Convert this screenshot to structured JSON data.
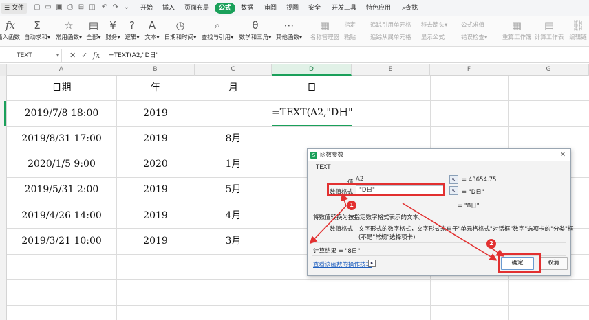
{
  "menu": {
    "file_label": "文件",
    "tabs": [
      "开始",
      "插入",
      "页面布局",
      "公式",
      "数据",
      "审阅",
      "视图",
      "安全",
      "开发工具",
      "特色应用"
    ],
    "active_tab": "公式",
    "search_label": "查找"
  },
  "ribbon": {
    "buttons": [
      {
        "label": "插入函数",
        "icon": "fx-icon"
      },
      {
        "label": "自动求和▾",
        "icon": "sigma-icon"
      },
      {
        "label": "常用函数▾",
        "icon": "star-function-icon"
      },
      {
        "label": "全部▾",
        "icon": "book-icon"
      },
      {
        "label": "财务▾",
        "icon": "finance-icon"
      },
      {
        "label": "逻辑▾",
        "icon": "logic-icon"
      },
      {
        "label": "文本▾",
        "icon": "text-icon"
      },
      {
        "label": "日期和时间▾",
        "icon": "clock-icon"
      },
      {
        "label": "查找与引用▾",
        "icon": "lookup-icon"
      },
      {
        "label": "数学和三角▾",
        "icon": "math-icon"
      },
      {
        "label": "其他函数▾",
        "icon": "more-functions-icon"
      },
      {
        "label": "名称管理器",
        "icon": "name-manager-icon"
      },
      {
        "label": "重算工作簿",
        "icon": "recalc-icon"
      },
      {
        "label": "计算工作表",
        "icon": "calc-sheet-icon"
      },
      {
        "label": "编辑链",
        "icon": "edit-links-icon"
      }
    ],
    "small": [
      "指定",
      "粘贴",
      "追踪引用单元格",
      "追踪从属单元格",
      "移去箭头▾",
      "显示公式",
      "公式求值",
      "错误检查▾"
    ]
  },
  "formula_bar": {
    "name_box": "TEXT",
    "formula": "=TEXT(A2,\"D日\""
  },
  "columns": [
    "A",
    "B",
    "C",
    "D",
    "E",
    "F",
    "G"
  ],
  "grid": {
    "header": [
      "日期",
      "年",
      "月",
      "日"
    ],
    "rows": [
      [
        "2019/7/8 18:00",
        "2019",
        ""
      ],
      [
        "2019/8/31 17:00",
        "2019",
        "8月"
      ],
      [
        "2020/1/5 9:00",
        "2020",
        "1月"
      ],
      [
        "2019/5/31 2:00",
        "2019",
        "5月"
      ],
      [
        "2019/4/26 14:00",
        "2019",
        "4月"
      ],
      [
        "2019/3/21 10:00",
        "2019",
        "3月"
      ]
    ],
    "editing_text": "=TEXT(A2,\"D日\""
  },
  "dialog": {
    "title": "函数参数",
    "func_name": "TEXT",
    "arg1_label": "值",
    "arg1_value": "A2",
    "arg1_result": "= 43654.75",
    "arg2_label": "数值格式",
    "arg2_value": "\"D日\"",
    "arg2_result": "= \"D日\"",
    "total_result": "= \"8日\"",
    "desc": "将数值转换为按指定数字格式表示的文本。",
    "param_desc_label": "数值格式:",
    "param_desc": "文字形式的数字格式，文字形式来自于\"单元格格式\"对话框\"数字\"选项卡的\"分类\"框",
    "param_desc2": "(不是\"常规\"选择项卡)",
    "calc_result": "计算结果 = \"8日\"",
    "help_link": "查看该函数的操作技巧",
    "ok_label": "确定",
    "cancel_label": "取消"
  },
  "annotations": {
    "badge1": "1",
    "badge2": "2"
  },
  "colors": {
    "accent": "#1aa05a",
    "annotation": "#e23030"
  }
}
